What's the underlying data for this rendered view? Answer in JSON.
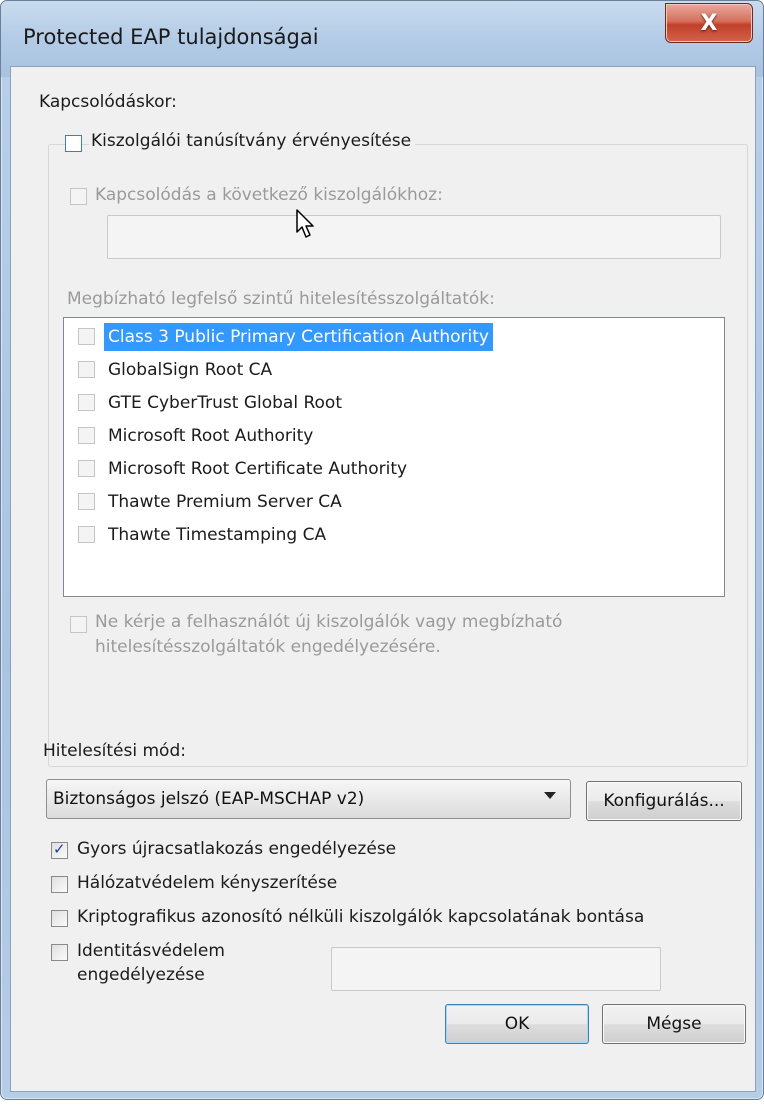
{
  "window": {
    "title": "Protected EAP tulajdonságai",
    "close_label": "X"
  },
  "on_connect_label": "Kapcsolódáskor:",
  "validate_server_cert": {
    "label": "Kiszolgálói tanúsítvány érvényesítése",
    "checked": false
  },
  "connect_to_servers": {
    "label": "Kapcsolódás a következő kiszolgálókhoz:",
    "value": ""
  },
  "trusted_cas": {
    "label": "Megbízható legfelső szintű hitelesítésszolgáltatók:",
    "items": [
      "Class 3 Public Primary Certification Authority",
      "GlobalSign Root CA",
      "GTE CyberTrust Global Root",
      "Microsoft Root Authority",
      "Microsoft Root Certificate Authority",
      "Thawte Premium Server CA",
      "Thawte Timestamping CA"
    ]
  },
  "no_prompt": {
    "line1": "Ne kérje a felhasználót új kiszolgálók vagy megbízható",
    "line2": "hitelesítésszolgáltatók engedélyezésére."
  },
  "auth_method": {
    "label": "Hitelesítési mód:",
    "selected": "Biztonságos jelszó (EAP-MSCHAP v2)",
    "configure_label": "Konfigurálás..."
  },
  "options": [
    {
      "label": "Gyors újracsatlakozás engedélyezése",
      "checked": true
    },
    {
      "label": "Hálózatvédelem kényszerítése",
      "checked": false
    },
    {
      "label": "Kriptografikus azonosító nélküli kiszolgálók kapcsolatának bontása",
      "checked": false
    }
  ],
  "identity_privacy": {
    "line1": "Identitásvédelem",
    "line2": "engedélyezése",
    "value": ""
  },
  "buttons": {
    "ok": "OK",
    "cancel": "Mégse"
  }
}
